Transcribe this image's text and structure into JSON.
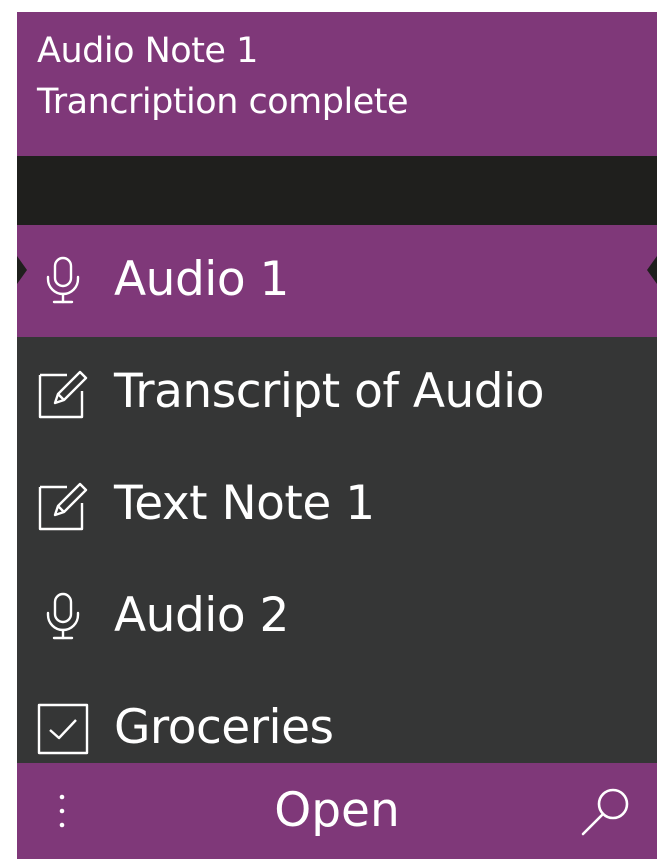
{
  "header": {
    "title": "Audio Note 1",
    "subtitle": "Trancription complete"
  },
  "list": {
    "items": [
      {
        "label": "Audio 1",
        "icon": "microphone-icon",
        "selected": true
      },
      {
        "label": "Transcript of Audio",
        "icon": "note-edit-icon",
        "selected": false
      },
      {
        "label": "Text Note 1",
        "icon": "note-edit-icon",
        "selected": false
      },
      {
        "label": "Audio 2",
        "icon": "microphone-icon",
        "selected": false
      },
      {
        "label": "Groceries",
        "icon": "checkbox-icon",
        "selected": false
      }
    ]
  },
  "bottom_bar": {
    "more_icon": "more-vertical-icon",
    "open_label": "Open",
    "search_icon": "search-icon"
  },
  "colors": {
    "accent": "#7f3879",
    "background": "#353636",
    "band": "#1f1f1d",
    "text": "#ffffff"
  }
}
